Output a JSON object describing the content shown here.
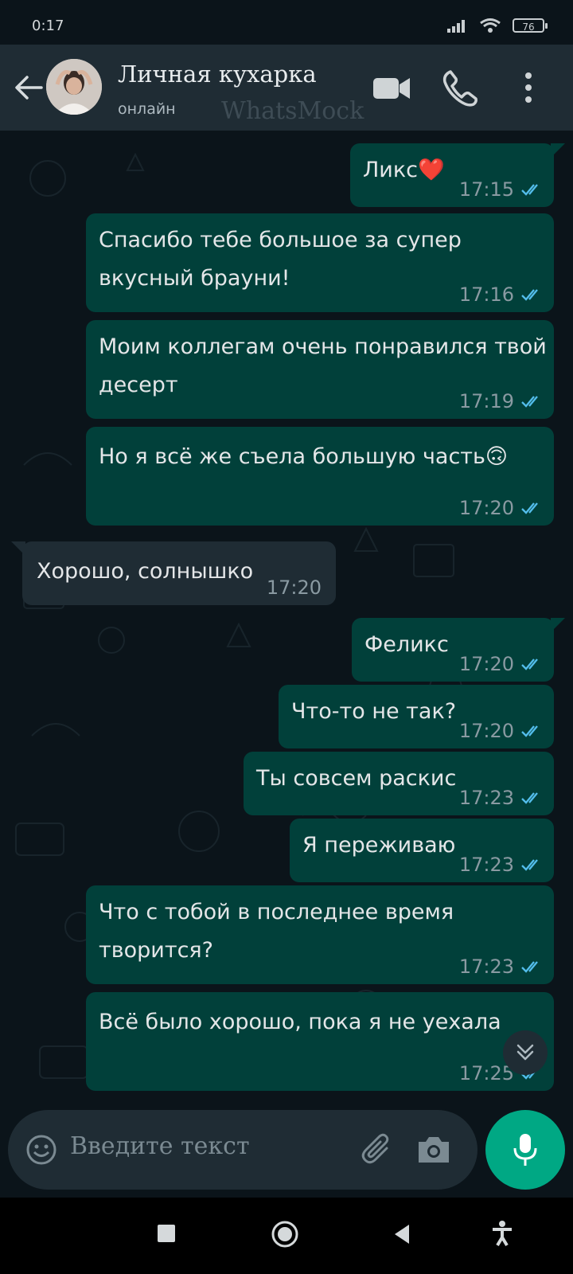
{
  "status_bar": {
    "time": "0:17",
    "battery": "76"
  },
  "header": {
    "contact_name": "Личная кухарка",
    "contact_status": "онлайн",
    "watermark": "WhatsMock"
  },
  "messages": [
    {
      "direction": "out",
      "text": "Ликс❤️",
      "time": "17:15",
      "read": true
    },
    {
      "direction": "out",
      "text": "Спасибо тебе большое за супер\nвкусный брауни!",
      "time": "17:16",
      "read": true
    },
    {
      "direction": "out",
      "text": "Моим коллегам очень понравился твой\nдесерт",
      "time": "17:19",
      "read": true
    },
    {
      "direction": "out",
      "text": "Но я всё же съела большую часть🙃",
      "time": "17:20",
      "read": true
    },
    {
      "direction": "in",
      "text": "Хорошо, солнышко",
      "time": "17:20"
    },
    {
      "direction": "out",
      "text": "Феликс",
      "time": "17:20",
      "read": true
    },
    {
      "direction": "out",
      "text": "Что-то не так?",
      "time": "17:20",
      "read": true
    },
    {
      "direction": "out",
      "text": "Ты совсем раскис",
      "time": "17:23",
      "read": true
    },
    {
      "direction": "out",
      "text": "Я переживаю",
      "time": "17:23",
      "read": true
    },
    {
      "direction": "out",
      "text": "Что с тобой в последнее время\nтворится?",
      "time": "17:23",
      "read": true
    },
    {
      "direction": "out",
      "text": "Всё было хорошо, пока я не уехала",
      "time": "17:25",
      "read": true
    }
  ],
  "composer": {
    "placeholder": "Введите текст"
  },
  "icons": {
    "back": "arrow-left-icon",
    "video": "video-camera-icon",
    "call": "phone-icon",
    "menu": "more-vertical-icon",
    "emoji": "emoji-icon",
    "attach": "paperclip-icon",
    "camera": "camera-icon",
    "mic": "microphone-icon",
    "scroll": "chevron-double-down-icon"
  },
  "colors": {
    "outgoing_bubble": "#01403a",
    "incoming_bubble": "#1f2c34",
    "header": "#1f2c34",
    "background": "#0b141a",
    "accent": "#00a884",
    "read_ticks": "#53bdeb"
  }
}
